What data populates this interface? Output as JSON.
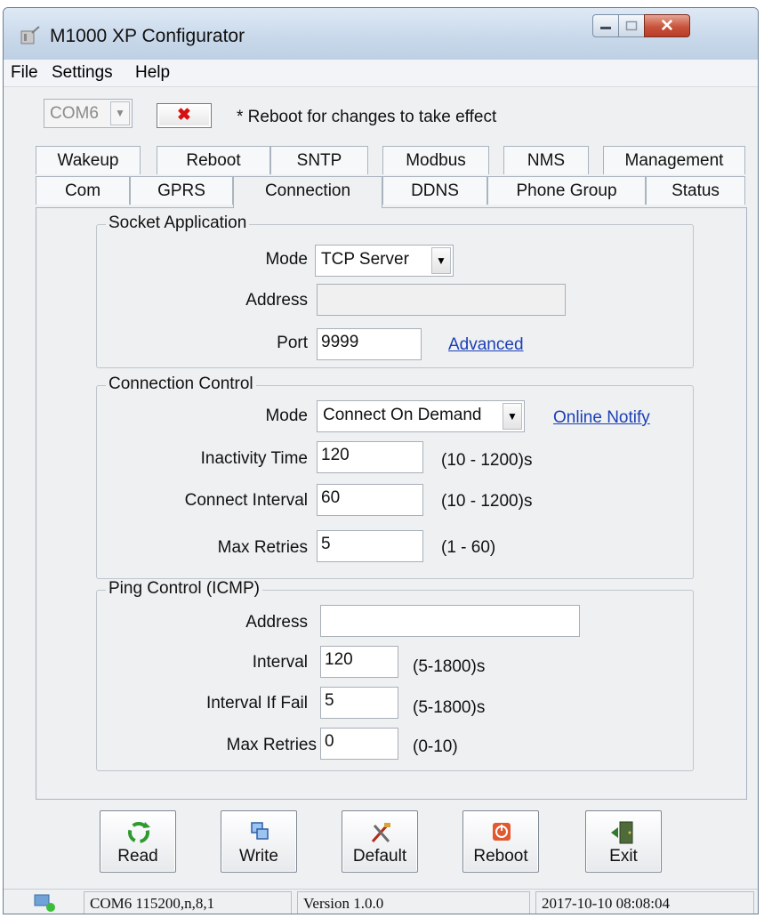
{
  "window": {
    "title": "M1000 XP Configurator"
  },
  "menu": {
    "file": "File",
    "settings": "Settings",
    "help": "Help"
  },
  "toolbar": {
    "com_port": "COM6",
    "disconnect_symbol": "✖",
    "reboot_note": "* Reboot for changes to take effect"
  },
  "tabs": {
    "row1": [
      "Wakeup",
      "Reboot",
      "SNTP",
      "Modbus",
      "NMS",
      "Management"
    ],
    "row2": [
      "Com",
      "GPRS",
      "Connection",
      "DDNS",
      "Phone Group",
      "Status"
    ],
    "active": "Connection"
  },
  "socket_application": {
    "legend": "Socket Application",
    "mode_label": "Mode",
    "mode_value": "TCP Server",
    "address_label": "Address",
    "address_value": "",
    "port_label": "Port",
    "port_value": "9999",
    "advanced_link": "Advanced"
  },
  "connection_control": {
    "legend": "Connection Control",
    "mode_label": "Mode",
    "mode_value": "Connect On Demand",
    "online_notify_link": "Online Notify",
    "inactivity_label": "Inactivity Time",
    "inactivity_value": "120",
    "inactivity_range": "(10 - 1200)s",
    "interval_label": "Connect Interval",
    "interval_value": "60",
    "interval_range": "(10 - 1200)s",
    "retries_label": "Max Retries",
    "retries_value": "5",
    "retries_range": "(1 - 60)"
  },
  "ping_control": {
    "legend": "Ping Control (ICMP)",
    "address_label": "Address",
    "address_value": "",
    "interval_label": "Interval",
    "interval_value": "120",
    "interval_range": "(5-1800)s",
    "fail_label": "Interval If Fail",
    "fail_value": "5",
    "fail_range": "(5-1800)s",
    "retries_label": "Max Retries",
    "retries_value": "0",
    "retries_range": "(0-10)"
  },
  "buttons": {
    "read": "Read",
    "write": "Write",
    "default": "Default",
    "reboot": "Reboot",
    "exit": "Exit"
  },
  "status_bar": {
    "port_settings": "COM6 115200,n,8,1",
    "version": "Version 1.0.0",
    "datetime": "2017-10-10 08:08:04"
  },
  "colors": {
    "link": "#1c3fb5",
    "close_button": "#c9533c",
    "disconnect_x": "#d51010"
  }
}
